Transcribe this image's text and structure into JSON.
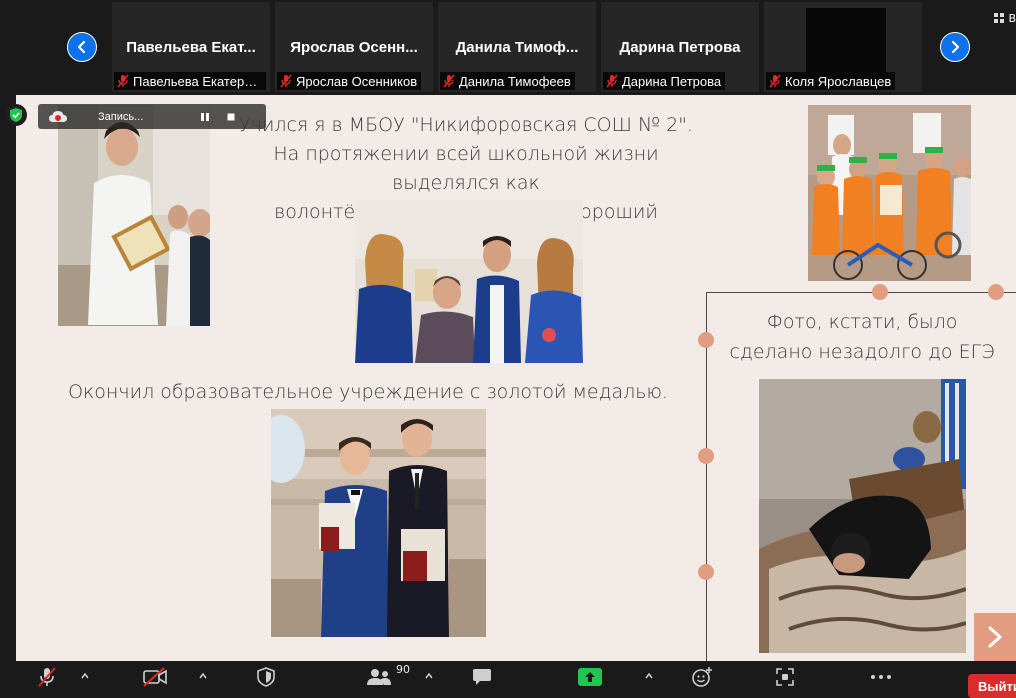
{
  "participants": [
    {
      "tile_name": "Павельева  Екат...",
      "caption": "Павельева Екатерин..."
    },
    {
      "tile_name": "Ярослав  Осенн...",
      "caption": "Ярослав Осенников"
    },
    {
      "tile_name": "Данила  Тимоф...",
      "caption": "Данила Тимофеев"
    },
    {
      "tile_name": "Дарина Петрова",
      "caption": "Дарина Петрова"
    },
    {
      "tile_name": "",
      "caption": "Коля Ярославцев"
    }
  ],
  "view_button_label": "В",
  "recording": {
    "label": "Запись..."
  },
  "slide": {
    "top_text": [
      "Учился я в МБОУ \"Никифоровская СОШ № 2\".",
      "На протяжении всей школьной жизни выделялся как",
      "волонтёр, активист и просто хороший человек."
    ],
    "middle_text": "Окончил образовательное учреждение с золотой медалью.",
    "right_caption": [
      "Фото, кстати, было",
      "сделано незадолго до ЕГЭ"
    ]
  },
  "toolbar": {
    "participants_count": "90",
    "leave_label": "Выйти"
  },
  "colors": {
    "accent": "#0e72ed",
    "slide_bg": "#f2ebe7",
    "timeline_dot": "#e29d80",
    "leave": "#d92d2d",
    "share_green": "#23c552"
  }
}
